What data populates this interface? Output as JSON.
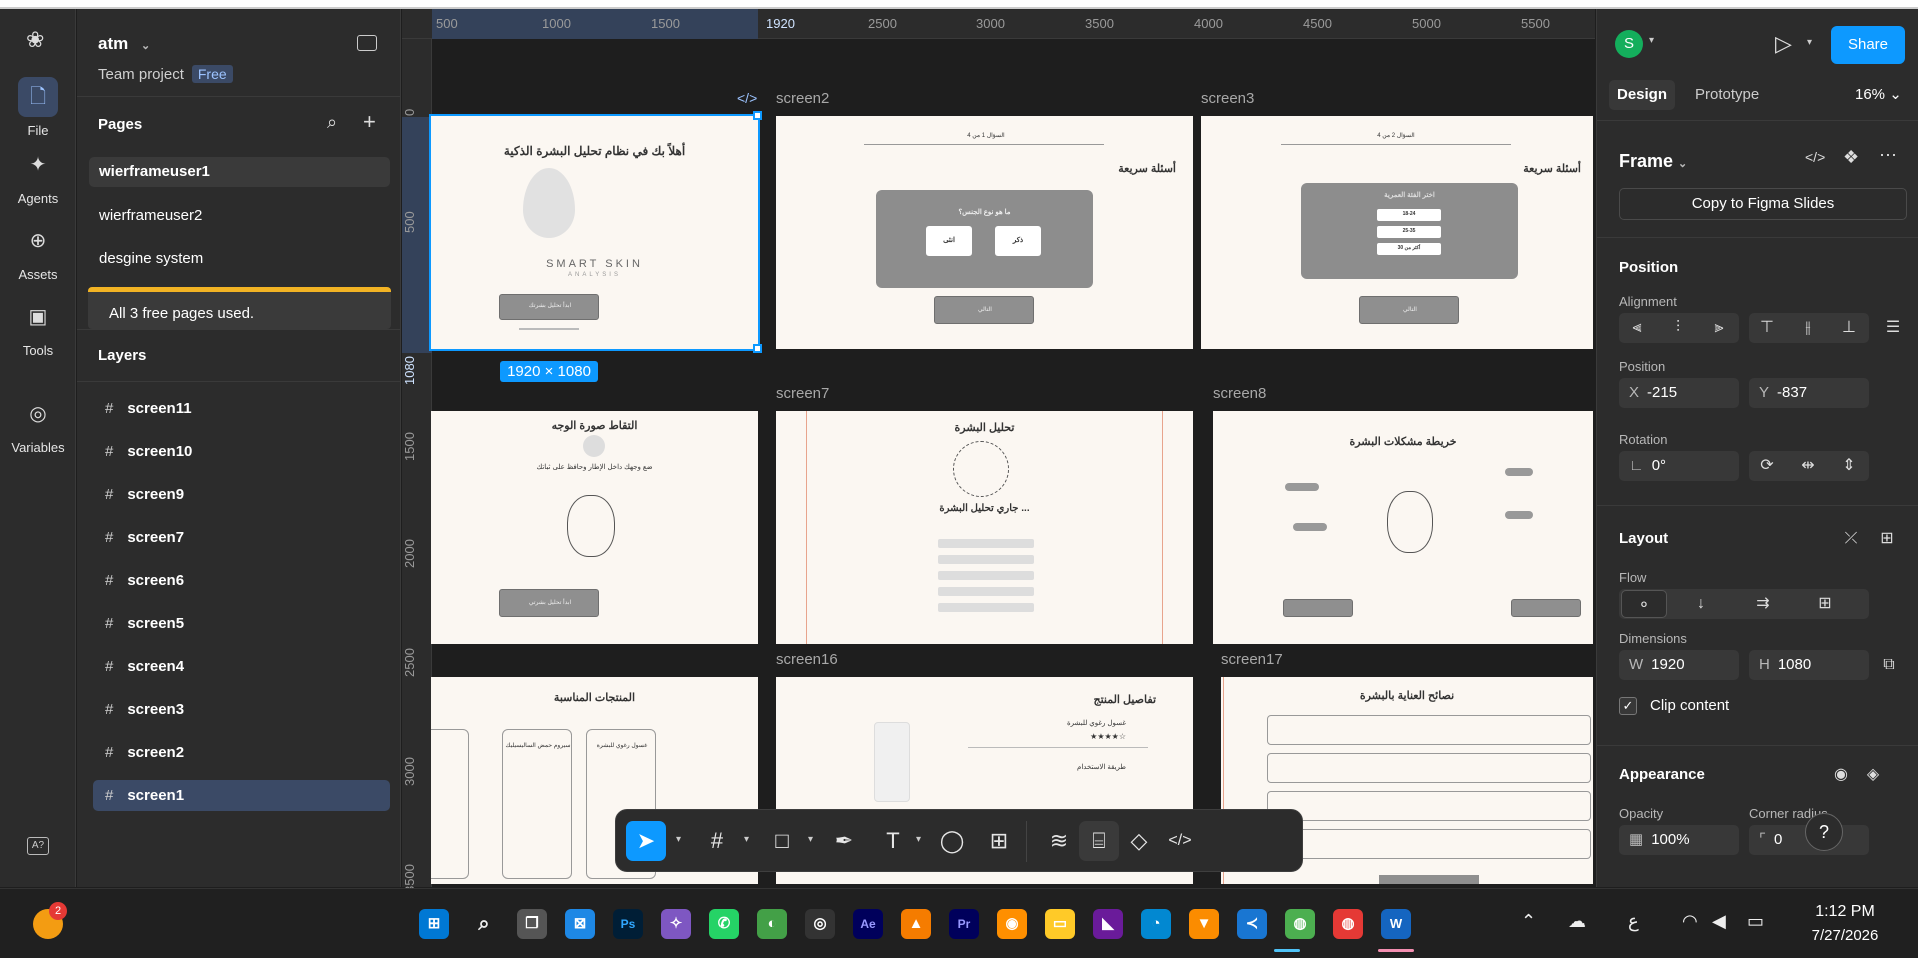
{
  "rail": {
    "items": [
      {
        "label": "File",
        "icon": "file-icon"
      },
      {
        "label": "Agents",
        "icon": "agents-icon"
      },
      {
        "label": "Assets",
        "icon": "assets-icon"
      },
      {
        "label": "Tools",
        "icon": "tools-icon"
      },
      {
        "label": "Variables",
        "icon": "variables-icon"
      }
    ]
  },
  "project": {
    "name": "atm",
    "team": "Team project",
    "plan": "Free"
  },
  "pages": {
    "title": "Pages",
    "items": [
      "wierframeuser1",
      "wierframeuser2",
      "desgine system"
    ],
    "banner": "All 3 free pages used."
  },
  "layers": {
    "title": "Layers",
    "items": [
      "screen11",
      "screen10",
      "screen9",
      "screen7",
      "screen6",
      "screen5",
      "screen4",
      "screen3",
      "screen2",
      "screen1"
    ],
    "selected": "screen1"
  },
  "rulers": {
    "h": [
      "500",
      "1000",
      "1500",
      "1920",
      "2500",
      "3000",
      "3500",
      "4000",
      "4500",
      "5000",
      "5500"
    ],
    "v": [
      "0",
      "500",
      "1080",
      "1500",
      "2000",
      "2500",
      "3000",
      "3500"
    ]
  },
  "canvas": {
    "frame_labels": [
      "screen2",
      "screen3",
      "screen7",
      "screen8",
      "screen16",
      "screen17"
    ],
    "selection_size": "1920 × 1080",
    "screen1": {
      "title": "أهلاً بك في نظام تحليل البشرة الذكية",
      "brand": "SMART SKIN",
      "brand_sub": "ANALYSIS",
      "button": "ابدأ تحليل بشرتك"
    },
    "screen2": {
      "progress": "السؤال 1 من 4",
      "heading": "أسئلة سريعة",
      "question": "ما هو نوع الجنس؟",
      "opt1": "انثى",
      "opt2": "ذكر",
      "next": "التالي"
    },
    "screen3": {
      "progress": "السؤال 2 من 4",
      "heading": "أسئلة سريعة",
      "question": "اختر الفئة العمرية",
      "opt1": "18-24",
      "opt2": "25-35",
      "opt3": "أكثر من 30",
      "next": "التالي"
    },
    "screen_face": {
      "heading": "التقاط صورة الوجه",
      "sub": "ضع وجهك داخل الإطار وحافظ على ثباتك",
      "button": "ابدأ تحليل بشرتي"
    },
    "screen7": {
      "heading": "تحليل البشرة",
      "status": "جاري تحليل البشرة ..."
    },
    "screen8": {
      "heading": "خريطة مشكلات البشرة"
    },
    "screen_products": {
      "heading": "المنتجات المناسبة",
      "p1": "غسول رغوي للبشرة",
      "p2": "سيروم حمض الساليسيليك"
    },
    "screen16": {
      "heading": "تفاصيل المنتج",
      "name": "غسول رغوي للبشرة",
      "stars": "★★★★☆",
      "usage": "طريقة الاستخدام"
    },
    "screen17": {
      "heading": "نصائح العناية بالبشرة"
    }
  },
  "toolbar": {
    "tools": [
      "move-tool",
      "frame-tool",
      "rectangle-tool",
      "pen-tool",
      "text-tool",
      "comment-tool",
      "actions-tool",
      "draw-tool",
      "dev-mode-tool",
      "component-tool",
      "code-tool"
    ]
  },
  "right": {
    "avatar": "S",
    "share": "Share",
    "tabs": [
      "Design",
      "Prototype"
    ],
    "zoom": "16%",
    "frame_title": "Frame",
    "copy_slides": "Copy to Figma Slides",
    "position_title": "Position",
    "alignment_label": "Alignment",
    "position_label": "Position",
    "x_label": "X",
    "x_value": "-215",
    "y_label": "Y",
    "y_value": "-837",
    "rotation_label": "Rotation",
    "rotation_value": "0°",
    "layout_title": "Layout",
    "flow_label": "Flow",
    "dimensions_label": "Dimensions",
    "w_label": "W",
    "w_value": "1920",
    "h_label": "H",
    "h_value": "1080",
    "clip_label": "Clip content",
    "appearance_title": "Appearance",
    "opacity_label": "Opacity",
    "opacity_value": "100%",
    "radius_label": "Corner radius",
    "radius_value": "0",
    "help": "?"
  },
  "taskbar": {
    "notification_count": "2",
    "apps": [
      "windows-start",
      "search",
      "task-view",
      "store",
      "photoshop",
      "copilot",
      "whatsapp",
      "corel",
      "obs",
      "after-effects",
      "premiere",
      "illustrator",
      "explorer",
      "visual-studio",
      "edge",
      "brave",
      "vscode",
      "chrome",
      "chrome-profile",
      "word"
    ],
    "lang": "ع",
    "time": "1:12 PM",
    "date": "7/27/2026"
  },
  "colors": {
    "accent": "#0d99ff",
    "banner": "#f2b324",
    "canvas": "#1e1e1e",
    "panel": "#2c2c2c"
  }
}
